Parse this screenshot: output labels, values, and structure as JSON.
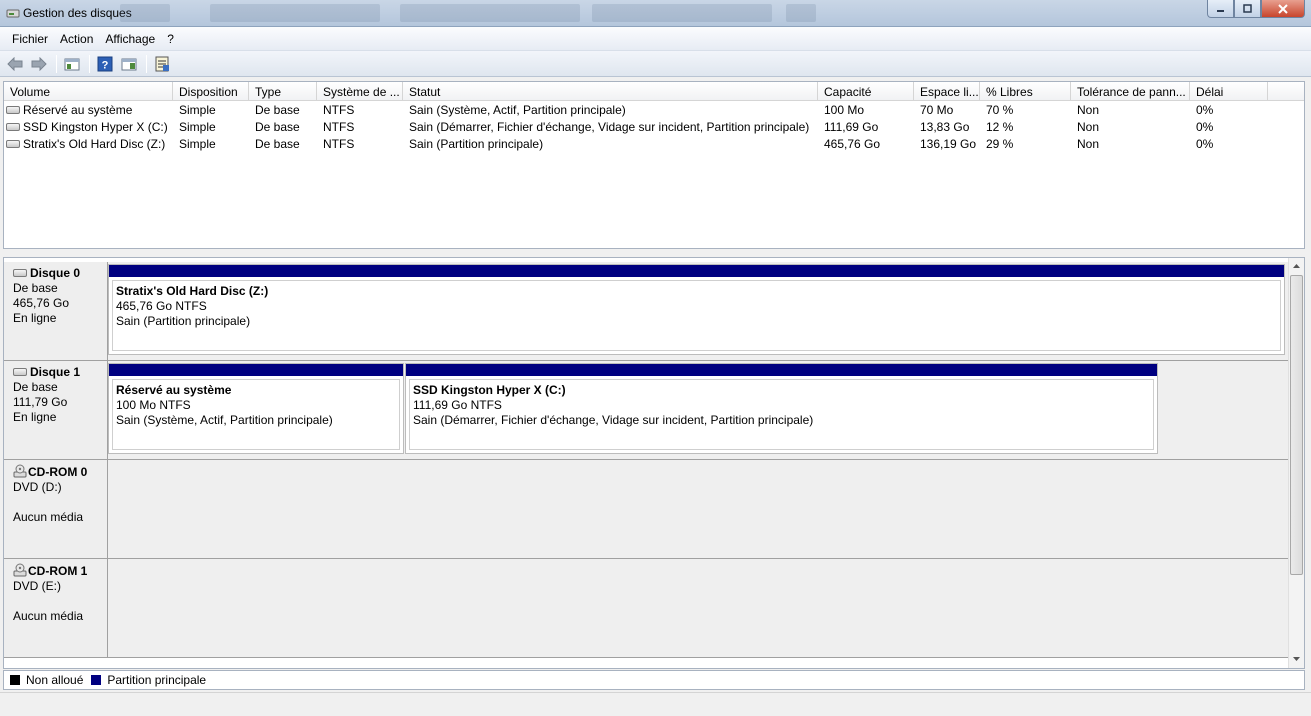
{
  "window": {
    "title": "Gestion des disques"
  },
  "menu": [
    "Fichier",
    "Action",
    "Affichage",
    "?"
  ],
  "toolbar": {
    "buttons": [
      "back-icon",
      "forward-icon",
      "console-tree-icon",
      "help-icon",
      "action-pane-icon",
      "properties-icon"
    ]
  },
  "volume_table": {
    "columns": [
      "Volume",
      "Disposition",
      "Type",
      "Système de ...",
      "Statut",
      "Capacité",
      "Espace li...",
      "% Libres",
      "Tolérance de pann...",
      "Délai"
    ],
    "rows": [
      [
        "Réservé au système",
        "Simple",
        "De base",
        "NTFS",
        "Sain (Système, Actif, Partition principale)",
        "100 Mo",
        "70 Mo",
        "70 %",
        "Non",
        "0%"
      ],
      [
        "SSD Kingston Hyper X (C:)",
        "Simple",
        "De base",
        "NTFS",
        "Sain (Démarrer, Fichier d'échange, Vidage sur incident, Partition principale)",
        "111,69 Go",
        "13,83 Go",
        "12 %",
        "Non",
        "0%"
      ],
      [
        "Stratix's Old Hard Disc (Z:)",
        "Simple",
        "De base",
        "NTFS",
        "Sain (Partition principale)",
        "465,76 Go",
        "136,19 Go",
        "29 %",
        "Non",
        "0%"
      ]
    ]
  },
  "disks": [
    {
      "name": "Disque 0",
      "type": "De base",
      "size": "465,76 Go",
      "state": "En ligne",
      "partitions": [
        {
          "name": "Stratix's Old Hard Disc  (Z:)",
          "size": "465,76 Go NTFS",
          "status": "Sain (Partition principale)"
        }
      ]
    },
    {
      "name": "Disque 1",
      "type": "De base",
      "size": "111,79 Go",
      "state": "En ligne",
      "partitions": [
        {
          "name": "Réservé au système",
          "size": "100 Mo NTFS",
          "status": "Sain (Système, Actif, Partition principale)"
        },
        {
          "name": "SSD Kingston Hyper X  (C:)",
          "size": "111,69 Go NTFS",
          "status": "Sain (Démarrer, Fichier d'échange, Vidage sur incident, Partition principale)"
        }
      ]
    },
    {
      "name": "CD-ROM 0",
      "type": "DVD (D:)",
      "state": "Aucun média"
    },
    {
      "name": "CD-ROM 1",
      "type": "DVD (E:)",
      "state": "Aucun média"
    }
  ],
  "legend": [
    {
      "label": "Non alloué",
      "color": "#000000"
    },
    {
      "label": "Partition principale",
      "color": "#000080"
    }
  ]
}
